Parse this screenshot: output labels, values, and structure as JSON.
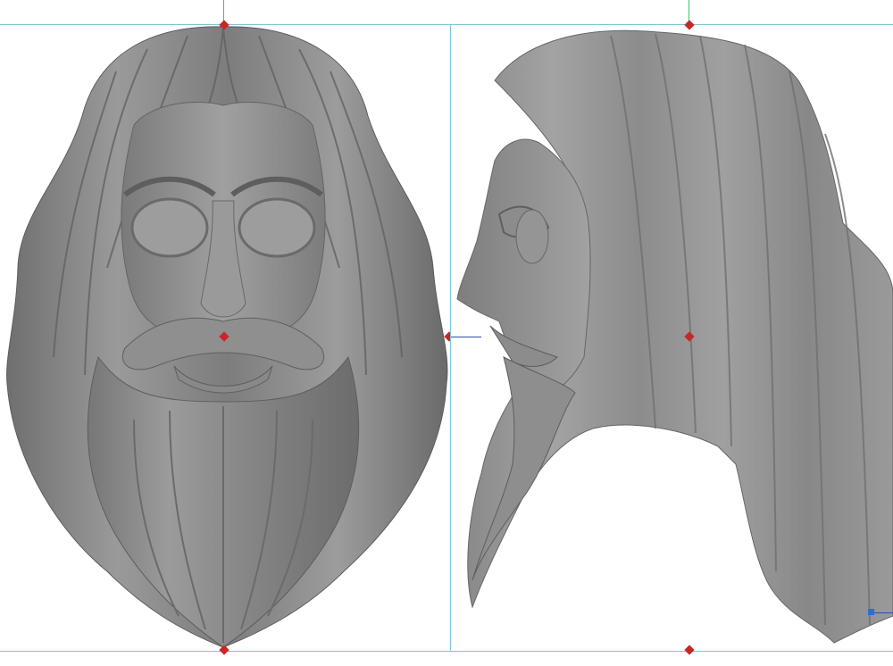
{
  "viewports": [
    {
      "id": "front",
      "label": ""
    },
    {
      "id": "side",
      "label": ""
    }
  ],
  "colors": {
    "background": "#ffffff",
    "guide": "#7fc5d8",
    "guide_green": "#3ec36a",
    "pivot": "#c62828",
    "handle": "#2a6fd1",
    "model_base": "#8a8a8a",
    "model_dark": "#5e5e5e",
    "model_light": "#a9a9a9"
  },
  "icons": {
    "pivot": "pivot-diamond-icon",
    "handle": "transform-handle-icon"
  }
}
